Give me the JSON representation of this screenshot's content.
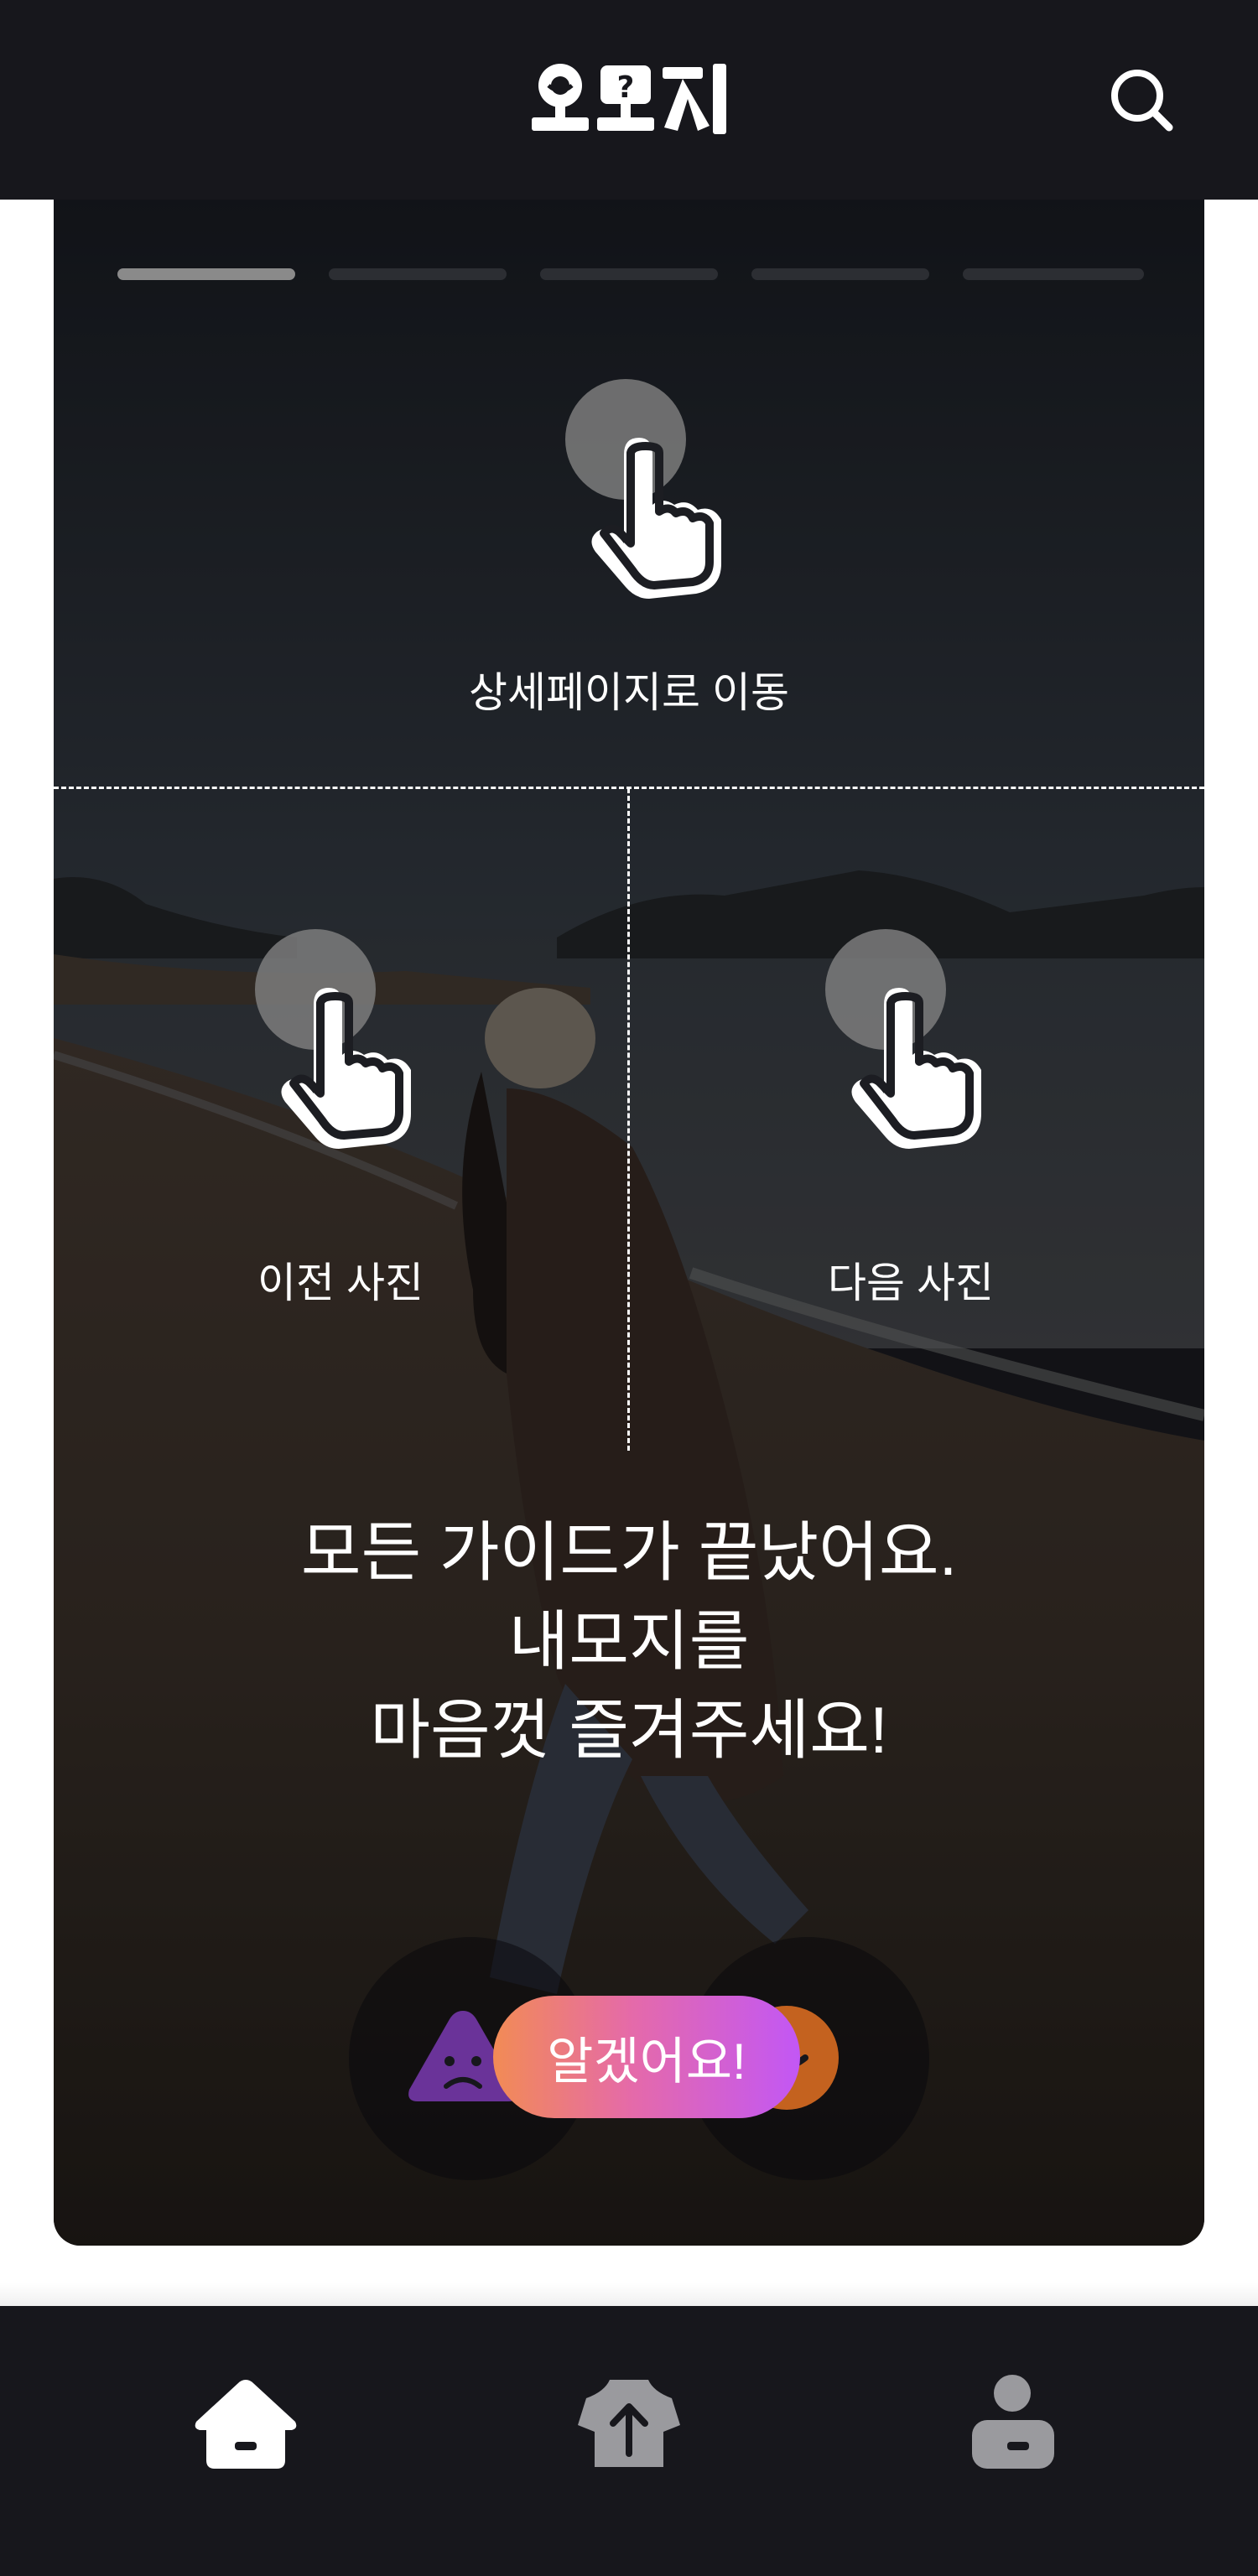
{
  "header": {
    "logo_text": "오모지",
    "search_icon": "search-icon"
  },
  "guide": {
    "progress_active_index": 0,
    "progress_segments": 5,
    "top_zone_label": "상세페이지로 이동",
    "left_zone_label": "이전 사진",
    "right_zone_label": "다음 사진",
    "hand_icon": "tap-hand-icon",
    "message_lines": [
      "모든 가이드가 끝났어요.",
      "내모지를",
      "마음껏 즐겨주세요!"
    ],
    "dots_count": 3,
    "confirm_label": "알겠어요!"
  },
  "reactions": {
    "left_icon": "sad-triangle-icon",
    "right_icon": "smile-face-icon"
  },
  "colors": {
    "header_bg": "#17171c",
    "button_gradient_start": "#f28b55",
    "button_gradient_end": "#c257f5",
    "sad_purple": "#7b3fb0",
    "smile_orange": "#e0722a"
  },
  "bottom_nav": {
    "items": [
      {
        "icon": "home-icon",
        "active": true
      },
      {
        "icon": "upload-shirt-icon",
        "active": false
      },
      {
        "icon": "profile-icon",
        "active": false
      }
    ]
  }
}
